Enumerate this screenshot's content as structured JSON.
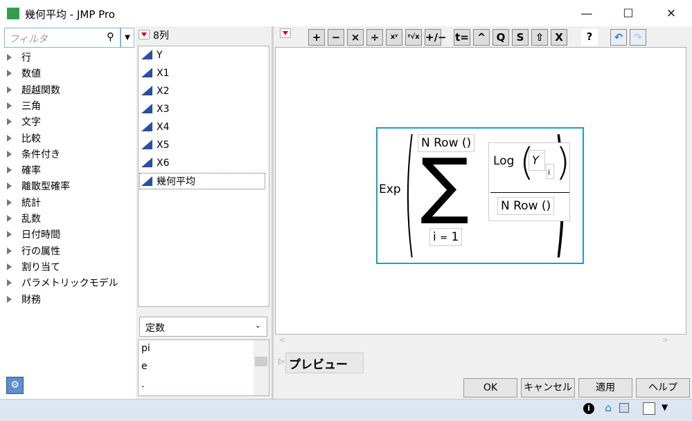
{
  "window": {
    "title": "幾何平均 - JMP Pro",
    "min": "—",
    "max": "☐",
    "close": "✕"
  },
  "filter": {
    "placeholder": "フィルタ"
  },
  "functions": [
    "行",
    "数値",
    "超越関数",
    "三角",
    "文字",
    "比較",
    "条件付き",
    "確率",
    "離散型確率",
    "統計",
    "乱数",
    "日付時間",
    "行の属性",
    "割り当て",
    "パラメトリックモデル",
    "財務"
  ],
  "columns": {
    "header": "8列",
    "items": [
      "Y",
      "X1",
      "X2",
      "X3",
      "X4",
      "X5",
      "X6",
      "幾何平均"
    ]
  },
  "constants": {
    "selected": "定数",
    "items": [
      "pi",
      "e",
      "."
    ]
  },
  "toolbar": [
    "+",
    "−",
    "×",
    "÷",
    "xʸ",
    "ʸ√x",
    "+∕−",
    "t=",
    "^",
    "Q",
    "S",
    "⇧",
    "X",
    "?",
    "↶",
    "↷"
  ],
  "formula": {
    "exp": "Exp",
    "upper": "N Row",
    "paren": "()",
    "log": "Log",
    "var": "Y",
    "sub": "i",
    "denom": "N Row",
    "index": "i",
    "eq": "=",
    "start": "1"
  },
  "preview": "プレビュー",
  "buttons": {
    "ok": "OK",
    "cancel": "キャンセル",
    "apply": "適用",
    "help": "ヘルプ"
  }
}
